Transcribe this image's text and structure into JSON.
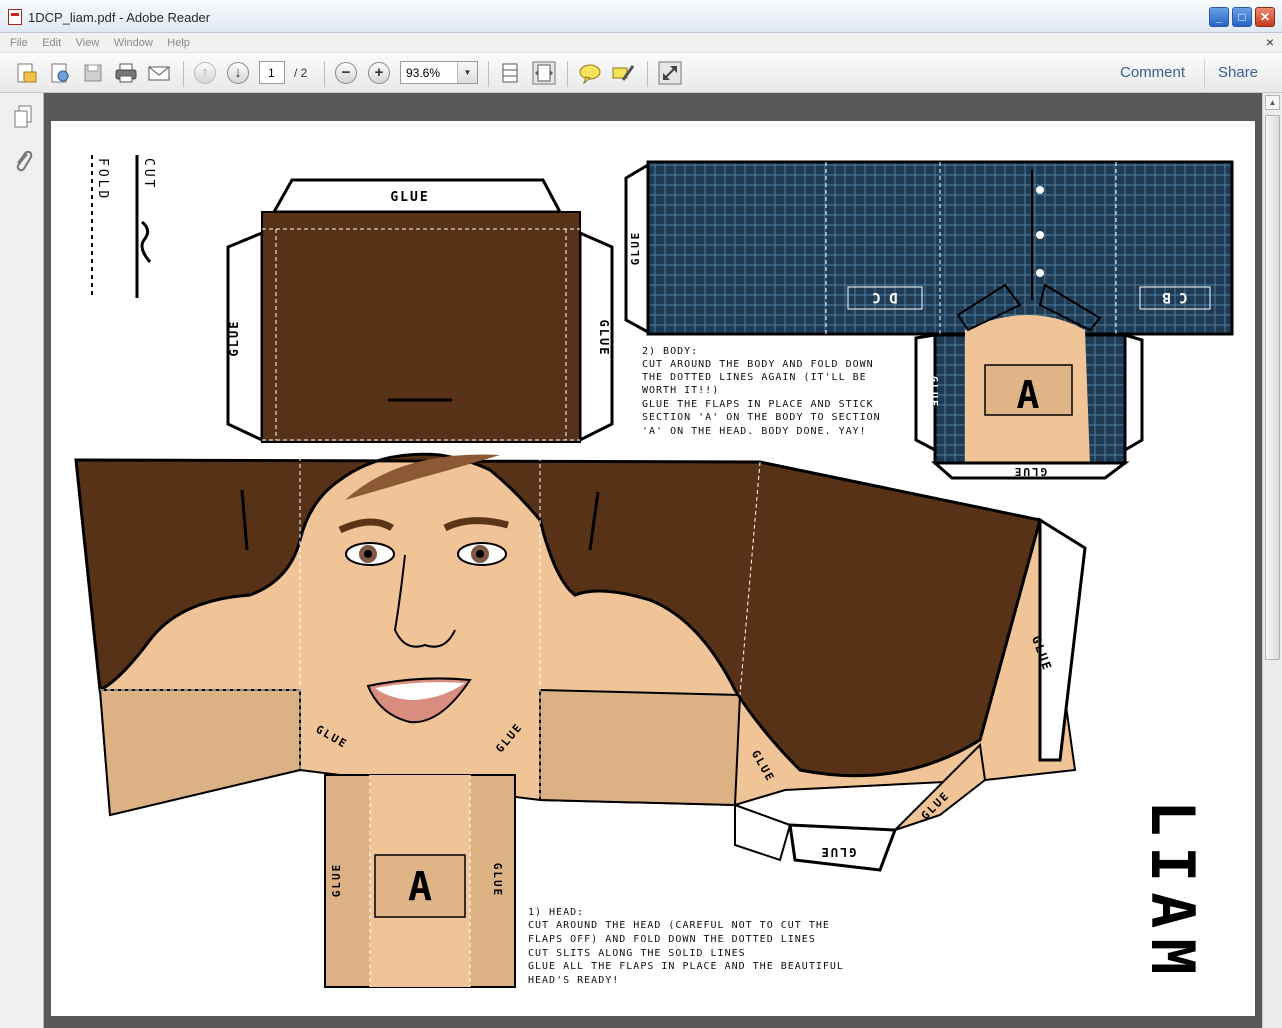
{
  "window": {
    "title": "1DCP_liam.pdf - Adobe Reader",
    "controls": {
      "minimize": "_",
      "maximize": "□",
      "close": "✕"
    }
  },
  "menu": {
    "items": [
      "File",
      "Edit",
      "View",
      "Window",
      "Help"
    ],
    "close_document": "×"
  },
  "toolbar": {
    "icons": [
      "create-pdf-icon",
      "edit-pdf-icon",
      "save-icon",
      "print-icon",
      "email-icon",
      "previous-page-icon",
      "next-page-icon",
      "zoom-out-icon",
      "zoom-in-icon",
      "fit-page-icon",
      "fit-width-icon",
      "comment-bubble-icon",
      "highlight-text-icon",
      "full-screen-icon"
    ],
    "page_current": "1",
    "page_total": "/ 2",
    "zoom": "93.6%",
    "comment_label": "Comment",
    "share_label": "Share"
  },
  "document": {
    "legend": {
      "cut": "CUT",
      "fold": "FOLD"
    },
    "glue_label": "GLUE",
    "section_a": "A",
    "shirt_tags": [
      "C  B",
      "D  C"
    ],
    "body_instructions": [
      "2) BODY:",
      "CUT AROUND THE BODY AND FOLD DOWN",
      "THE DOTTED LINES AGAIN (IT'LL BE",
      "WORTH IT!!)",
      "GLUE THE FLAPS IN PLACE AND STICK",
      "SECTION 'A' ON THE BODY TO SECTION",
      "'A' ON THE HEAD. BODY DONE. YAY!"
    ],
    "head_instructions": [
      "1) HEAD:",
      "CUT AROUND THE HEAD (CAREFUL NOT TO CUT THE",
      "FLAPS OFF) AND FOLD DOWN THE DOTTED LINES",
      "CUT SLITS ALONG THE SOLID LINES",
      "GLUE ALL THE FLAPS IN PLACE AND THE BEAUTIFUL",
      "HEAD'S READY!"
    ],
    "name": "LIAM"
  },
  "colors": {
    "hair": "#573217",
    "skin": "#f0c496",
    "skin_shadow": "#dcb285",
    "shirt": "#1f3b53",
    "doc_background": "#585858"
  }
}
